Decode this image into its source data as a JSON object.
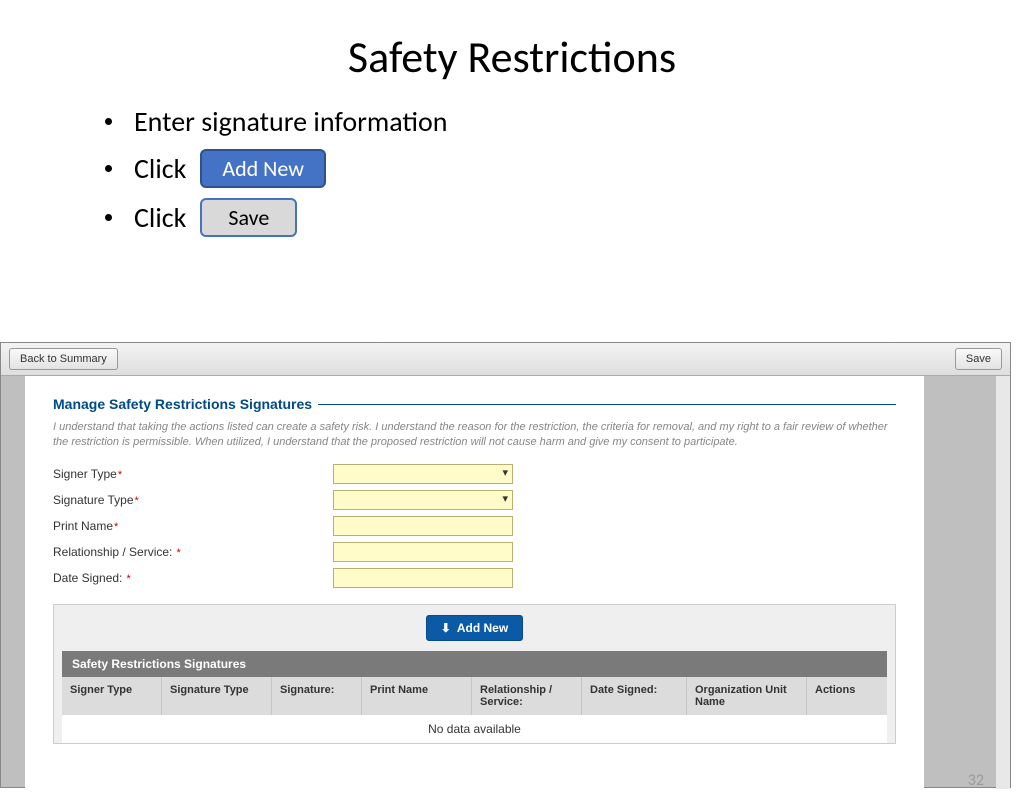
{
  "title": "Safety Restrictions",
  "bullets": {
    "b1": "Enter signature information",
    "b2_prefix": "Click",
    "b2_btn": "Add New",
    "b3_prefix": "Click",
    "b3_btn": "Save"
  },
  "toolbar": {
    "back": "Back to Summary",
    "save": "Save"
  },
  "section_header": "Manage Safety Restrictions Signatures",
  "disclaimer": "I understand that taking the actions listed can create a safety risk. I understand the reason for the restriction, the criteria for removal, and my right to a fair review of whether the restriction is permissible. When utilized, I understand that the proposed restriction will not cause harm and give my consent to participate.",
  "fields": {
    "signer_type": "Signer Type",
    "signature_type": "Signature Type",
    "print_name": "Print Name",
    "relationship": "Relationship / Service:",
    "date_signed": "Date Signed:"
  },
  "add_new": "Add New",
  "grid": {
    "title": "Safety Restrictions Signatures",
    "cols": {
      "c1": "Signer Type",
      "c2": "Signature Type",
      "c3": "Signature:",
      "c4": "Print Name",
      "c5": "Relationship / Service:",
      "c6": "Date Signed:",
      "c7": "Organization Unit Name",
      "c8": "Actions"
    },
    "no_data": "No data available"
  },
  "page_number": "32"
}
